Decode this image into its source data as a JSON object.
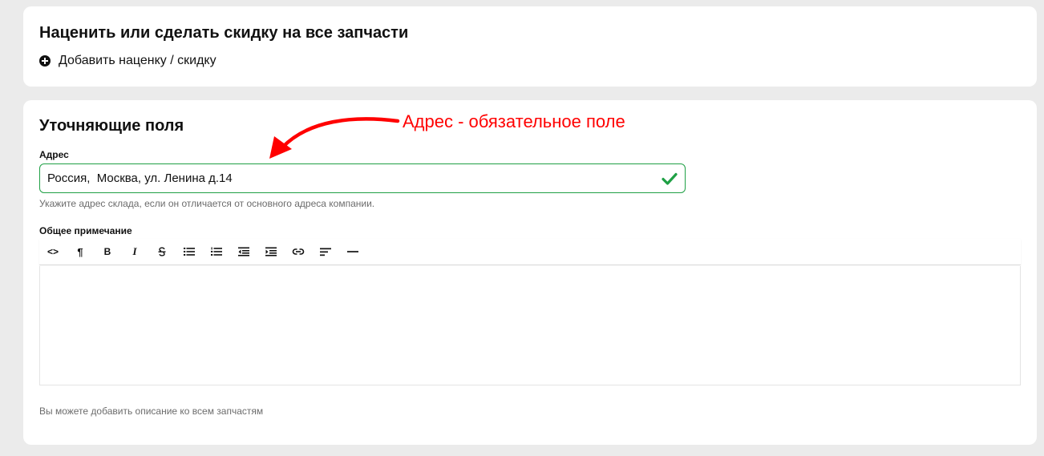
{
  "markup_section": {
    "title": "Наценить или сделать скидку на все запчасти",
    "add_label": "Добавить наценку / скидку"
  },
  "details_section": {
    "title": "Уточняющие поля",
    "address": {
      "label": "Адрес",
      "value": "Россия,  Москва, ул. Ленина д.14",
      "hint": "Укажите адрес склада, если он отличается от основного адреса компании.",
      "valid": true
    },
    "note": {
      "label": "Общее примечание",
      "value": "",
      "hint": "Вы можете добавить описание ко всем запчастям",
      "toolbar": [
        "code-icon",
        "paragraph-icon",
        "bold-icon",
        "italic-icon",
        "strikethrough-icon",
        "bullet-list-icon",
        "numbered-list-icon",
        "outdent-icon",
        "indent-icon",
        "link-icon",
        "align-left-icon",
        "horizontal-rule-icon"
      ],
      "toolbar_glyphs": {
        "code": "<>",
        "paragraph": "¶",
        "bold": "B",
        "italic": "I"
      }
    }
  },
  "annotation": {
    "text": "Адрес - обязательное поле",
    "color": "#ff0000"
  },
  "colors": {
    "valid": "#1fa045",
    "background": "#ebebeb",
    "card": "#ffffff"
  }
}
